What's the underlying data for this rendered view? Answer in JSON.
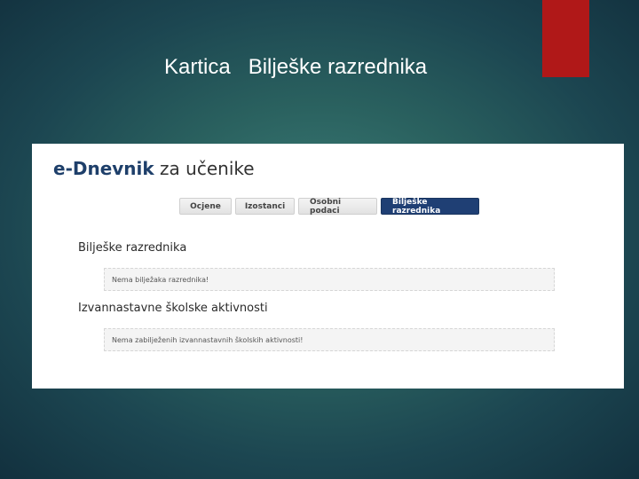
{
  "slide": {
    "title": "Kartica   Bilješke razrednika",
    "accent_color": "#b01818"
  },
  "app": {
    "title_brand": "e-Dnevnik",
    "title_rest": " za učenike",
    "brand_color": "#1e3f6a"
  },
  "tabs": [
    {
      "label": "Ocjene",
      "active": false
    },
    {
      "label": "Izostanci",
      "active": false
    },
    {
      "label": "Osobni podaci",
      "active": false
    },
    {
      "label": "Bilješke razrednika",
      "active": true
    }
  ],
  "sections": [
    {
      "heading": "Bilješke razrednika",
      "message": "Nema bilježaka razrednika!"
    },
    {
      "heading": "Izvannastavne školske aktivnosti",
      "message": "Nema zabilježenih izvannastavnih školskih aktivnosti!"
    }
  ]
}
